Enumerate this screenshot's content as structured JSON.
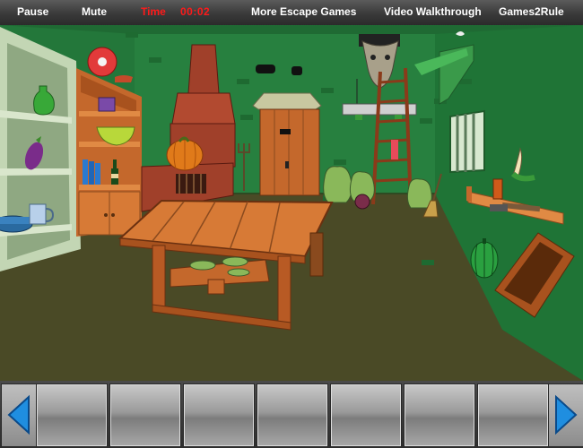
{
  "topbar": {
    "pause": "Pause",
    "mute": "Mute",
    "time_label": "Time",
    "time_value": "00:02",
    "more_games": "More Escape Games",
    "walkthrough": "Video Walkthrough",
    "brand": "Games2Rule"
  },
  "inventory": {
    "slot_count": 7,
    "left_arrow_icon": "arrow-left-icon",
    "right_arrow_icon": "arrow-right-icon"
  },
  "colors": {
    "wall": "#27803f",
    "wall_dark": "#1b5e2d",
    "floor": "#4a4a26",
    "wood": "#d77a36",
    "time_red": "#ff1a1a",
    "arrow_blue": "#1f8ee0"
  }
}
